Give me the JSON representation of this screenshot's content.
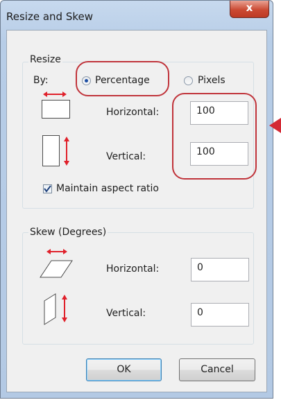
{
  "window": {
    "title": "Resize and Skew",
    "close_glyph": "x"
  },
  "resize": {
    "group_label": "Resize",
    "by_label": "By:",
    "options": [
      {
        "label": "Percentage",
        "selected": true
      },
      {
        "label": "Pixels",
        "selected": false
      }
    ],
    "horizontal_label": "Horizontal:",
    "horizontal_value": "100",
    "vertical_label": "Vertical:",
    "vertical_value": "100",
    "maintain_label": "Maintain aspect ratio",
    "maintain_checked": true
  },
  "skew": {
    "group_label": "Skew (Degrees)",
    "horizontal_label": "Horizontal:",
    "horizontal_value": "0",
    "vertical_label": "Vertical:",
    "vertical_value": "0"
  },
  "buttons": {
    "ok": "OK",
    "cancel": "Cancel"
  },
  "colors": {
    "annotation": "#c0333a",
    "arrow": "#e0202a"
  }
}
